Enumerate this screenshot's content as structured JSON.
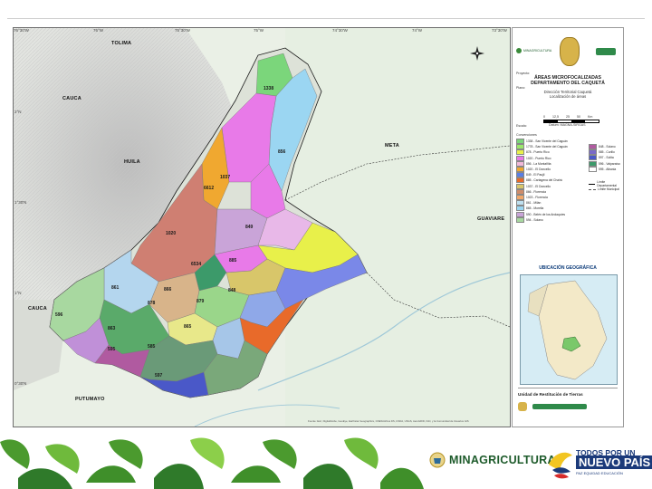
{
  "map": {
    "region_labels": {
      "tolima": "TOLIMA",
      "cauca_north": "CAUCA",
      "huila": "HUILA",
      "meta": "META",
      "guaviare": "GUAVIARE",
      "cauca_south": "CAUCA",
      "putumayo": "PUTUMAYO"
    },
    "municipality_labels": {
      "m1": "1338",
      "m2": "856",
      "m3": "1037",
      "m4": "6612",
      "m5": "1020",
      "m6": "849",
      "m7": "6534",
      "m8": "885",
      "m9": "861",
      "m10": "866",
      "m11": "878",
      "m12": "879",
      "m13": "848",
      "m14": "596",
      "m15": "863",
      "m16": "865",
      "m17": "585",
      "m18": "595",
      "m19": "597"
    },
    "top_ticks": [
      "76°30'W",
      "76°W",
      "75°30'W",
      "75°W",
      "74°30'W",
      "74°W",
      "73°30'W",
      "73°W"
    ],
    "left_ticks": [
      "2°N",
      "1°30'N",
      "1°N",
      "0°30'N"
    ],
    "credit": "Fuente: Esri, DigitalGlobe, GeoEye, Earthstar Geographics, CNES/Airbus DS, USDA, USGS, AeroGRID, IGN, y la Comunidad de Usuarios GIS"
  },
  "legend": {
    "header_label": "MINAGRICULTURA",
    "proyecto": "Proyecto:",
    "title_line1": "ÁREAS MICROFOCALIZADAS",
    "title_line2": "DEPARTAMENTO DEL CAQUETÁ",
    "plano": "Plano:",
    "sub1": "Dirección Territorial Caquetá",
    "sub2": "Localización de áreas",
    "escala": "Escala:",
    "scale_values": [
      "0",
      "12,5",
      "25",
      "50",
      "Km"
    ],
    "datum": "Datum: MAGNA-SIRGAS",
    "convenciones": "Convenciones",
    "items": [
      {
        "label": "1338 - San Vicente del Caguán",
        "color": "#7bd67b"
      },
      {
        "label": "1778 - San Vicente del Caguán",
        "color": "#9be86b"
      },
      {
        "label": "878 - Puerto Rico",
        "color": "#e8f04a"
      },
      {
        "label": "1020 - Puerto Rico",
        "color": "#e87ae8"
      },
      {
        "label": "856 - La Montañita",
        "color": "#f2b8d8"
      },
      {
        "label": "1020 - El Doncello",
        "color": "#f0a830"
      },
      {
        "label": "849 - El Paujil",
        "color": "#5a7ee6"
      },
      {
        "label": "885 - Cartagena del Chairá",
        "color": "#e86a2a"
      },
      {
        "label": "1037 - El Doncello",
        "color": "#d8c66a"
      },
      {
        "label": "866 - Florencia",
        "color": "#cf8c6a"
      },
      {
        "label": "1023 - Florencia",
        "color": "#f2a86a"
      },
      {
        "label": "861 - Milán",
        "color": "#bfe0f0"
      },
      {
        "label": "865 - Morelia",
        "color": "#9bd6f2"
      },
      {
        "label": "590 - Belén de los Andaquíes",
        "color": "#c9a4d8"
      },
      {
        "label": "594 - Solano",
        "color": "#a8d8a0"
      }
    ],
    "side_items": [
      {
        "label": "848 - Solano",
        "color": "#b05aa0"
      },
      {
        "label": "585 - Curillo",
        "color": "#7a6ac8"
      },
      {
        "label": "597 - Solita",
        "color": "#4a58c8"
      },
      {
        "label": "596 - Valparaíso",
        "color": "#3c9a6a"
      },
      {
        "label": "595 - Albania",
        "color": "#ffffff"
      }
    ],
    "line_items": [
      "Límite Departamental",
      "Límite Municipal"
    ],
    "ubicacion": "UBICACIÓN GEOGRÁFICA",
    "bottom_title": "Unidad de Restitución de Tierras"
  },
  "banner": {
    "minagri": "MINAGRICULTURA",
    "todos_line1": "TODOS POR UN",
    "todos_line2": "NUEVO PAÍS",
    "todos_line3": "PAZ   EQUIDAD   EDUCACIÓN"
  }
}
